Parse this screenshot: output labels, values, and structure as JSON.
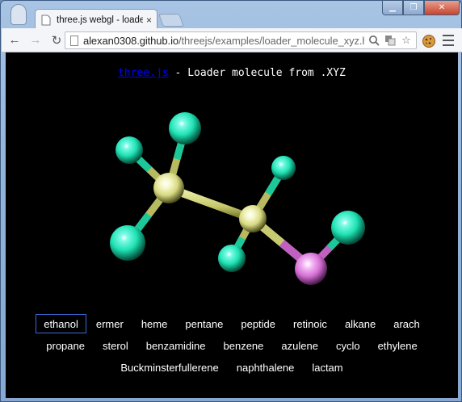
{
  "browser": {
    "tab": {
      "title": "three.js webgl - loader mo",
      "close": "×"
    },
    "url": {
      "host": "alexan0308.github.io",
      "path": "/threejs/examples/loader_molecule_xyz.html"
    },
    "window_controls": {
      "minimize": "▁",
      "maximize": "❐",
      "close": "✕"
    },
    "nav": {
      "back": "←",
      "forward": "→",
      "reload": "↻"
    },
    "omnibox_icons": {
      "zoom": "⚲",
      "translate": "⎘",
      "bookmark": "☆"
    }
  },
  "page": {
    "info_link": "three.js",
    "info_text": " - Loader molecule from .XYZ"
  },
  "molecules": {
    "selected": "ethanol",
    "items": [
      "ethanol",
      "ermer",
      "heme",
      "pentane",
      "peptide",
      "retinoic",
      "alkane",
      "arach",
      "propane",
      "sterol",
      "benzamidine",
      "benzene",
      "azulene",
      "cyclo",
      "ethylene",
      "Buckminsterfullerene",
      "naphthalene",
      "lactam"
    ]
  },
  "colors": {
    "hydrogen": "#20e0b0",
    "carbon": "#e8eaa0",
    "oxygen": "#e070e0",
    "active_border": "#3a6bd8"
  }
}
